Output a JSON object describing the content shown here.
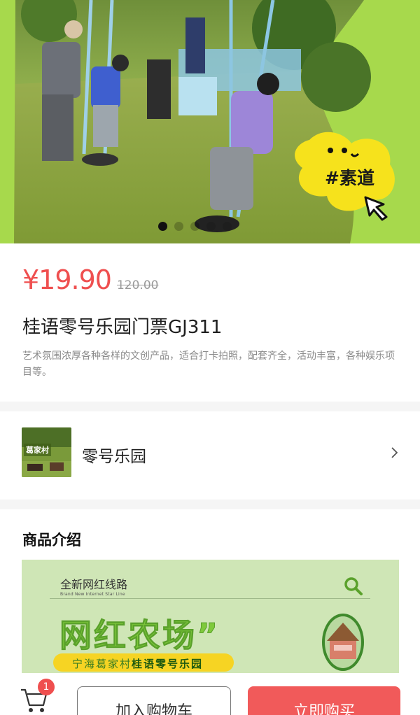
{
  "hero": {
    "brand_label": "#素道",
    "slide_count": 5,
    "active_slide": 1
  },
  "product": {
    "price": "¥19.90",
    "original_price": "120.00",
    "title": "桂语零号乐园门票GJ311",
    "description": "艺术氛围浓厚各种各样的文创产品，适合打卡拍照，配套齐全，活动丰富，各种娱乐项目等。"
  },
  "shop": {
    "thumb_label": "葛家村",
    "name": "零号乐园"
  },
  "intro": {
    "heading": "商品介绍",
    "banner": {
      "kicker": "全新网红线路",
      "sub": "Brand New Internet Star Line",
      "title": "网红农场”",
      "pill_prefix": "宁海葛家村",
      "pill_strong": "桂语零号乐园"
    }
  },
  "bottom_bar": {
    "cart_count": "1",
    "add_to_cart_label": "加入购物车",
    "buy_now_label": "立即购买"
  },
  "colors": {
    "price_red": "#ef4f4f",
    "buy_button": "#f15a5a",
    "brand_green": "#a7d94c",
    "brand_yellow": "#f6e21c"
  },
  "icons": [
    "arrow-cursor-icon",
    "chevron-right-icon",
    "search-icon",
    "cart-icon"
  ]
}
